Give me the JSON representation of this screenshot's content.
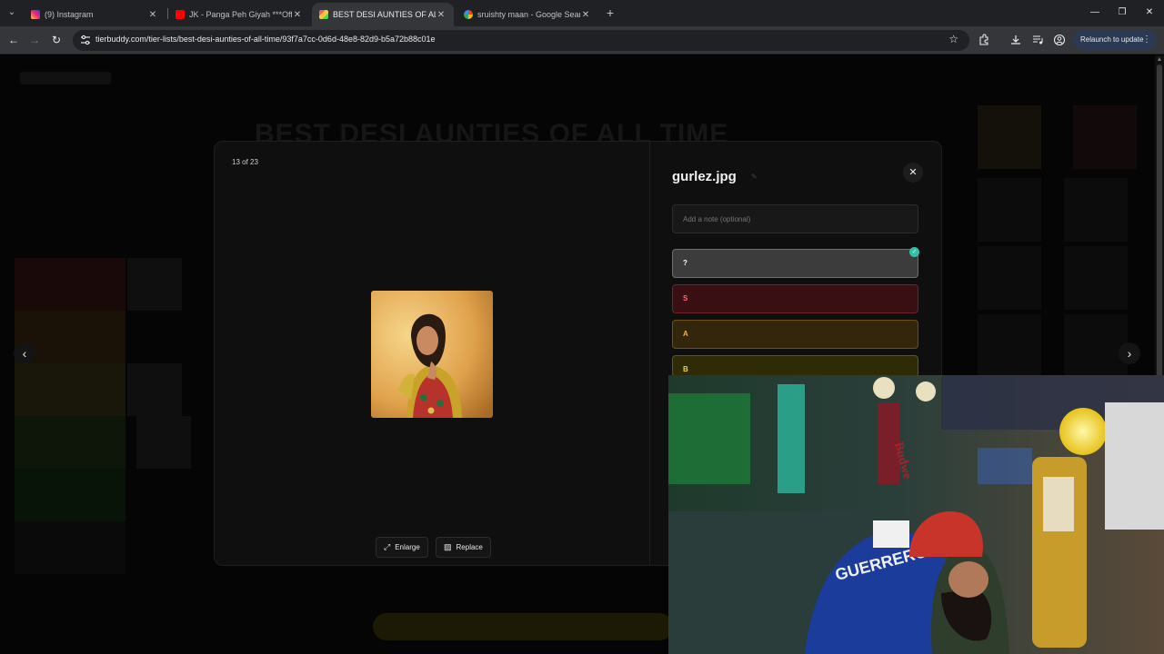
{
  "browser": {
    "tabs": [
      {
        "title": "(9) Instagram",
        "favicon_color": "#e1306c"
      },
      {
        "title": "JK - Panga Peh Giyah ***Official",
        "favicon_color": "#ff0000"
      },
      {
        "title": "BEST DESI AUNTIES OF ALL TIME",
        "favicon_color": "#2a2a2a"
      },
      {
        "title": "sruishty maan - Google Search",
        "favicon_color": "#4285f4"
      }
    ],
    "url": "tierbuddy.com/tier-lists/best-desi-aunties-of-all-time/93f7a7cc-0d6d-48e8-82d9-b5a72b88c01e",
    "relaunch_label": "Relaunch to update"
  },
  "page": {
    "bg_title": "BEST DESI AUNTIES OF ALL TIME"
  },
  "modal": {
    "counter": "13 of 23",
    "file_name": "gurlez.jpg",
    "note_placeholder": "Add a note (optional)",
    "tiers": [
      {
        "label": "?",
        "selected": true
      },
      {
        "label": "S",
        "selected": false
      },
      {
        "label": "A",
        "selected": false
      },
      {
        "label": "B",
        "selected": false
      }
    ],
    "enlarge_label": "Enlarge",
    "replace_label": "Replace"
  },
  "colors": {
    "accent_check": "#2ec2a6",
    "tier_s": "#ff6b7a",
    "tier_a": "#f5b340",
    "tier_b": "#e8d53a"
  },
  "webcam": {
    "jersey_text": "GUERRERO",
    "sign_text": "Budwe"
  }
}
